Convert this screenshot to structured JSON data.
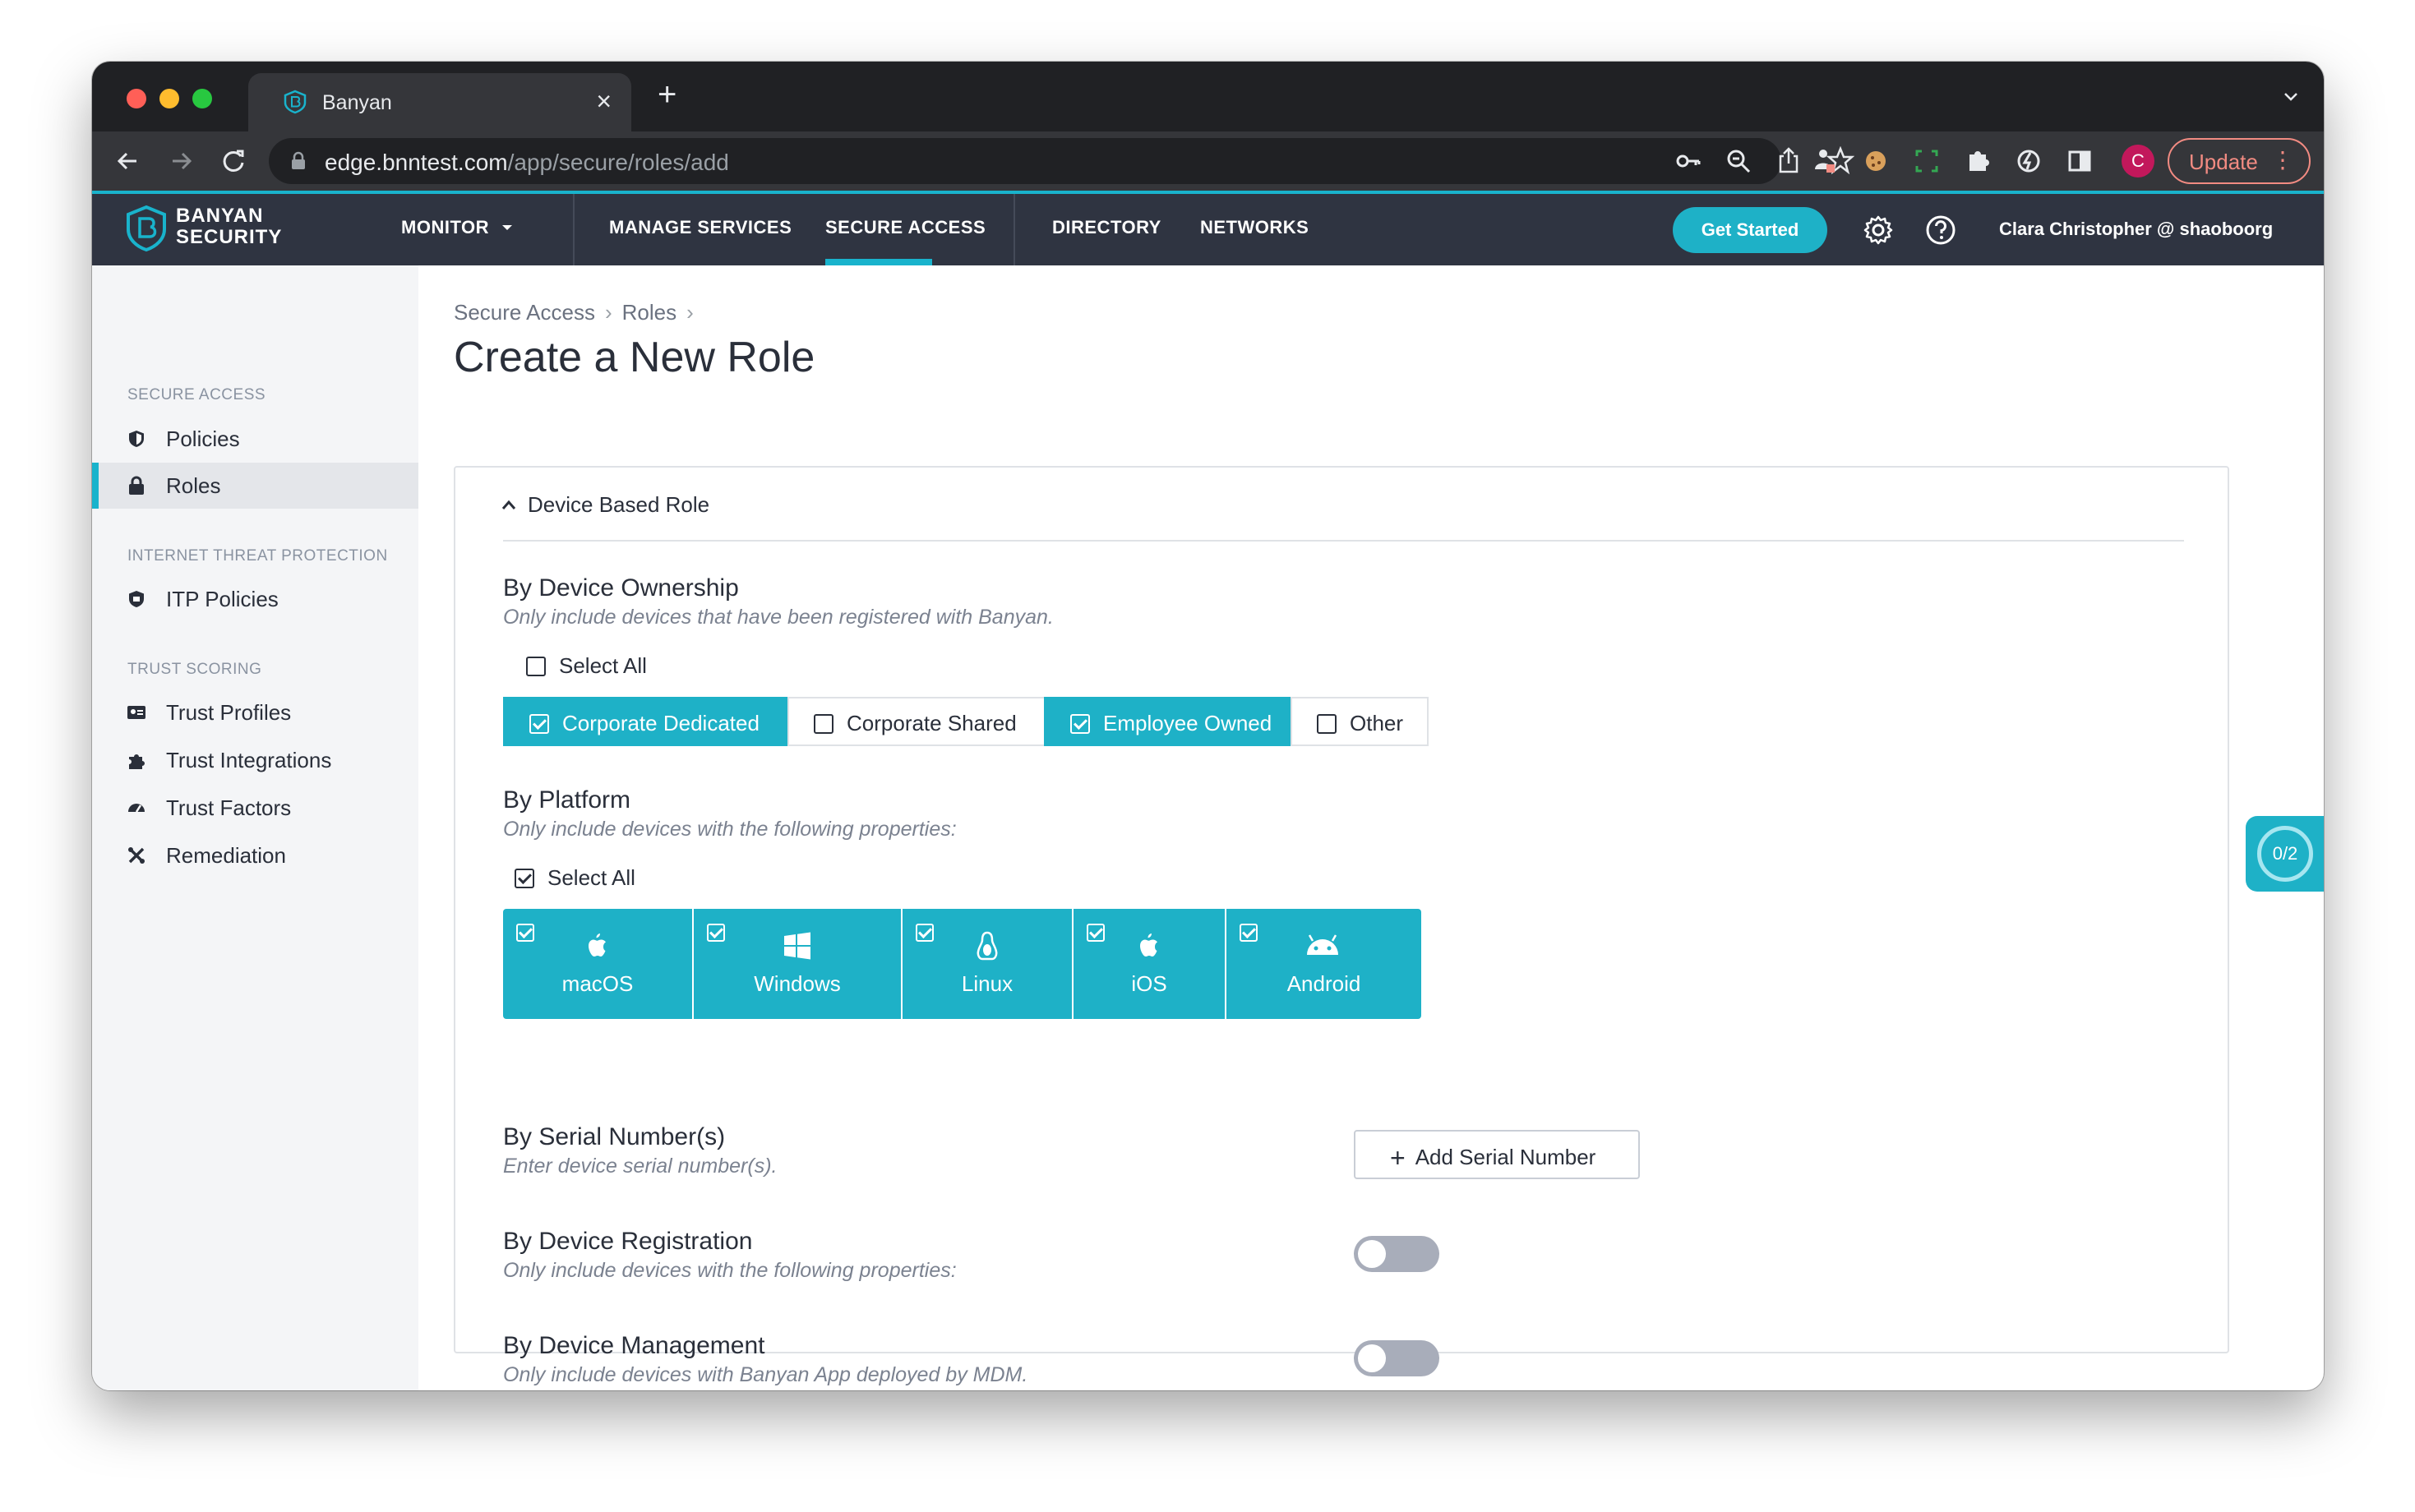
{
  "browser": {
    "tab_title": "Banyan",
    "url_host": "edge.bnntest.com",
    "url_path": "/app/secure/roles/add",
    "profile_initial": "C",
    "update_label": "Update"
  },
  "header": {
    "logo_line1": "BANYAN",
    "logo_line2": "SECURITY",
    "nav": [
      "MONITOR",
      "MANAGE SERVICES",
      "SECURE ACCESS",
      "DIRECTORY",
      "NETWORKS"
    ],
    "get_started": "Get Started",
    "user": "Clara Christopher @ shaoboorg"
  },
  "sidebar": {
    "sections": [
      {
        "heading": "SECURE ACCESS",
        "items": [
          "Policies",
          "Roles"
        ]
      },
      {
        "heading": "INTERNET THREAT PROTECTION",
        "items": [
          "ITP Policies"
        ]
      },
      {
        "heading": "TRUST SCORING",
        "items": [
          "Trust Profiles",
          "Trust Integrations",
          "Trust Factors",
          "Remediation"
        ]
      }
    ],
    "active_item": "Roles"
  },
  "breadcrumb": [
    "Secure Access",
    "Roles"
  ],
  "page_title": "Create a New Role",
  "card": {
    "section_title": "Device Based Role",
    "ownership": {
      "label": "By Device Ownership",
      "sub": "Only include devices that have been registered with Banyan.",
      "select_all": "Select All",
      "options": [
        {
          "label": "Corporate Dedicated",
          "checked": true
        },
        {
          "label": "Corporate Shared",
          "checked": false
        },
        {
          "label": "Employee Owned",
          "checked": true
        },
        {
          "label": "Other",
          "checked": false
        }
      ]
    },
    "platform": {
      "label": "By Platform",
      "sub": "Only include devices with the following properties:",
      "select_all": "Select All",
      "options": [
        "macOS",
        "Windows",
        "Linux",
        "iOS",
        "Android"
      ]
    },
    "serial": {
      "label": "By Serial Number(s)",
      "sub": "Enter device serial number(s).",
      "button": "Add Serial Number"
    },
    "registration": {
      "label": "By Device Registration",
      "sub": "Only include devices with the following properties:",
      "enabled": false
    },
    "management": {
      "label": "By Device Management",
      "sub": "Only include devices with Banyan App deployed by MDM.",
      "enabled": false
    }
  },
  "widget": {
    "progress": "0/2"
  },
  "colors": {
    "accent": "#1eb1c7",
    "appbar": "#2f3441",
    "chrome": "#202124"
  }
}
